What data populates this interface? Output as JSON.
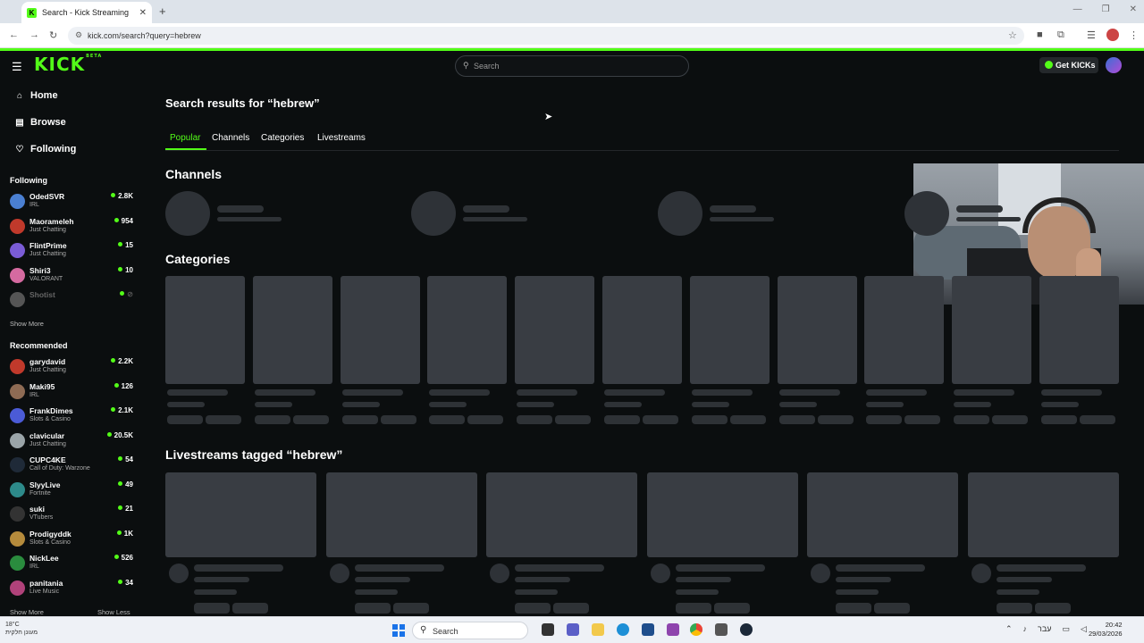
{
  "browser": {
    "tab_title": "Search - Kick Streaming",
    "tab_close": "✕",
    "new_tab": "+",
    "url": "kick.com/search?query=hebrew"
  },
  "header": {
    "logo": "KICK",
    "logo_badge": "BETA",
    "search_placeholder": "Search",
    "get_kicks": "Get KICKs"
  },
  "sidebar": {
    "nav": [
      {
        "label": "Home",
        "icon": "home-icon"
      },
      {
        "label": "Browse",
        "icon": "browse-icon"
      },
      {
        "label": "Following",
        "icon": "heart-icon"
      }
    ],
    "following_title": "Following",
    "following": [
      {
        "name": "OdedSVR",
        "category": "IRL",
        "viewers": "2.8K",
        "color": "#4a7fd1"
      },
      {
        "name": "Maorameleh",
        "category": "Just Chatting",
        "viewers": "954",
        "color": "#c0392b"
      },
      {
        "name": "FlintPrime",
        "category": "Just Chatting",
        "viewers": "15",
        "color": "#7a5cd6"
      },
      {
        "name": "Shiri3",
        "category": "VALORANT",
        "viewers": "10",
        "color": "#d56aa0"
      },
      {
        "name": "Shotist",
        "category": "",
        "viewers": "",
        "color": "#555"
      }
    ],
    "following_show_more": "Show More",
    "recommended_title": "Recommended",
    "recommended": [
      {
        "name": "garydavid",
        "category": "Just Chatting",
        "viewers": "2.2K",
        "color": "#c0392b"
      },
      {
        "name": "Maki95",
        "category": "IRL",
        "viewers": "126",
        "color": "#8e6b54"
      },
      {
        "name": "FrankDimes",
        "category": "Slots & Casino",
        "viewers": "2.1K",
        "color": "#4b5bd6"
      },
      {
        "name": "clavicular",
        "category": "Just Chatting",
        "viewers": "20.5K",
        "color": "#9aa4a8"
      },
      {
        "name": "CUPC4KE",
        "category": "Call of Duty: Warzone",
        "viewers": "54",
        "color": "#1f2a38"
      },
      {
        "name": "SlyyLive",
        "category": "Fortnite",
        "viewers": "49",
        "color": "#2d8a8a"
      },
      {
        "name": "suki",
        "category": "VTubers",
        "viewers": "21",
        "color": "#333"
      },
      {
        "name": "Prodigyddk",
        "category": "Slots & Casino",
        "viewers": "1K",
        "color": "#b58b3c"
      },
      {
        "name": "NickLee",
        "category": "IRL",
        "viewers": "526",
        "color": "#2a8c3e"
      },
      {
        "name": "panitania",
        "category": "Live Music",
        "viewers": "34",
        "color": "#b0427a"
      }
    ],
    "show_more": "Show More",
    "show_less": "Show Less"
  },
  "main": {
    "title": "Search results for “hebrew”",
    "tabs": [
      "Popular",
      "Channels",
      "Categories",
      "Livestreams"
    ],
    "channels_heading": "Channels",
    "categories_heading": "Categories",
    "livestreams_heading": "Livestreams tagged “hebrew”"
  },
  "taskbar": {
    "weather_temp": "18°C",
    "weather_desc": "מעונן חלקית",
    "search": "Search",
    "lang": "עבר",
    "time": "20:42",
    "date": "29/03/2026"
  }
}
